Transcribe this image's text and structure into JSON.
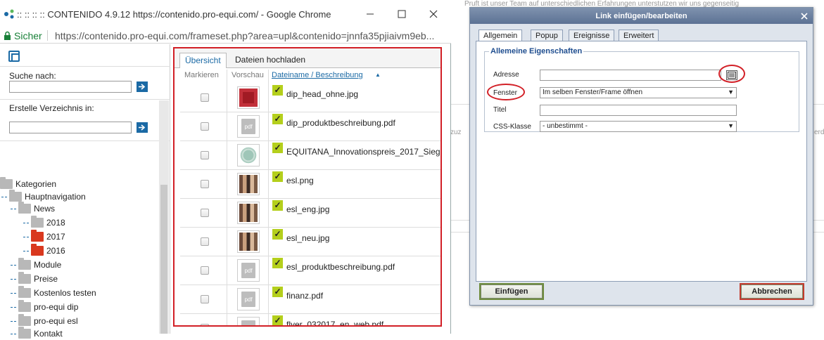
{
  "browser": {
    "window_title": ":: :: :: :: CONTENIDO 4.9.12 https://contenido.pro-equi.com/ - Google Chrome",
    "secure_label": "Sicher",
    "url": "https://contenido.pro-equi.com/frameset.php?area=upl&contenido=jnnfa35pjiaivm9eb..."
  },
  "left_panel": {
    "search_label": "Suche nach:",
    "create_dir_label": "Erstelle Verzeichnis in:",
    "tree": [
      {
        "label": "Kategorien",
        "color": "gray"
      },
      {
        "label": "Hauptnavigation",
        "color": "gray"
      },
      {
        "label": "News",
        "color": "gray"
      },
      {
        "label": "2018",
        "color": "gray"
      },
      {
        "label": "2017",
        "color": "red"
      },
      {
        "label": "2016",
        "color": "red"
      },
      {
        "label": "Module",
        "color": "gray"
      },
      {
        "label": "Preise",
        "color": "gray"
      },
      {
        "label": "Kostenlos testen",
        "color": "gray"
      },
      {
        "label": "pro-equi dip",
        "color": "gray"
      },
      {
        "label": "pro-equi esl",
        "color": "gray"
      },
      {
        "label": "Kontakt",
        "color": "gray"
      }
    ]
  },
  "files": {
    "tabs": [
      "Übersicht",
      "Dateien hochladen"
    ],
    "headers": {
      "mark": "Markieren",
      "preview": "Vorschau",
      "name": "Dateiname / Beschreibung"
    },
    "rows": [
      {
        "name": "dip_head_ohne.jpg",
        "thumb": "image-red"
      },
      {
        "name": "dip_produktbeschreibung.pdf",
        "thumb": "pdf"
      },
      {
        "name": "EQUITANA_Innovationspreis_2017_Sieg",
        "thumb": "image-seal"
      },
      {
        "name": "esl.png",
        "thumb": "image-photo"
      },
      {
        "name": "esl_eng.jpg",
        "thumb": "image-photo"
      },
      {
        "name": "esl_neu.jpg",
        "thumb": "image-photo"
      },
      {
        "name": "esl_produktbeschreibung.pdf",
        "thumb": "pdf"
      },
      {
        "name": "finanz.pdf",
        "thumb": "pdf"
      },
      {
        "name": "flyer_032017_en_web.pdf",
        "thumb": "pdf"
      }
    ],
    "pdf_label": "pdf",
    "check_mark": "✓"
  },
  "dialog": {
    "title": "Link einfügen/bearbeiten",
    "tabs": [
      "Allgemein",
      "Popup",
      "Ereignisse",
      "Erweitert"
    ],
    "legend": "Allemeine Eigenschaften",
    "fields": {
      "address_label": "Adresse",
      "address_value": "",
      "window_label": "Fenster",
      "window_value": "Im selben Fenster/Frame öffnen",
      "title_label": "Titel",
      "title_value": "",
      "css_label": "CSS-Klasse",
      "css_value": "- unbestimmt -"
    },
    "insert_label": "Einfügen",
    "cancel_label": "Abbrechen"
  },
  "background_page": {
    "fragment_top": "Pruft ist unser Team auf unterschiedlichen Erfahrungen unterstutzen wir uns gegenseitig",
    "fragment_left": "zuz",
    "fragment_right": "erd"
  },
  "colors": {
    "accent_blue": "#1b6aa5",
    "highlight_red": "#d21f26",
    "check_green": "#b4cf1c"
  }
}
